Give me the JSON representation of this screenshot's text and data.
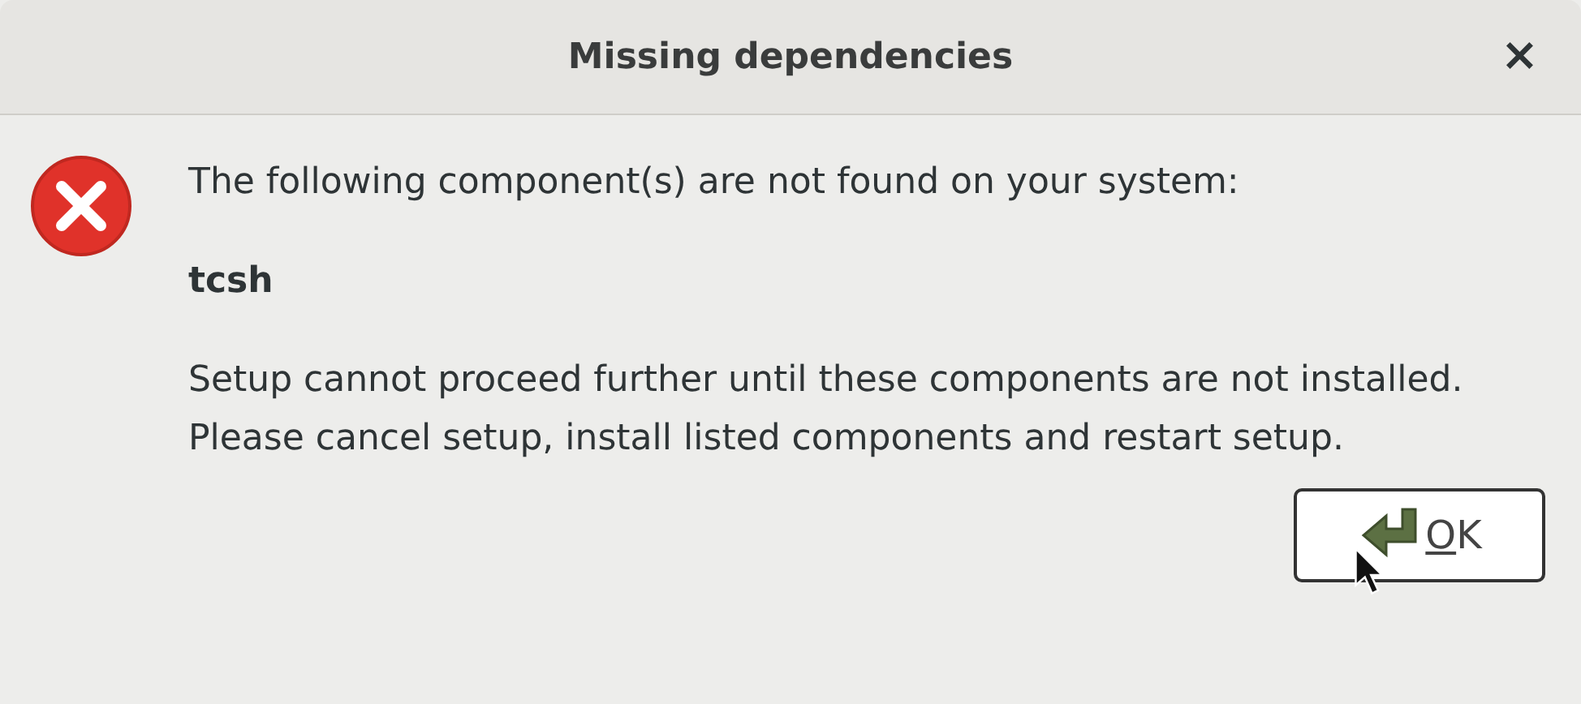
{
  "window": {
    "title": "Missing dependencies",
    "close": "×"
  },
  "message": {
    "intro": "The following component(s) are not found on your system:",
    "components": [
      "tcsh"
    ],
    "details": "Setup cannot proceed further until these components are not installed. Please cancel setup, install listed components and restart setup."
  },
  "buttons": [
    {
      "label": "OK"
    }
  ]
}
